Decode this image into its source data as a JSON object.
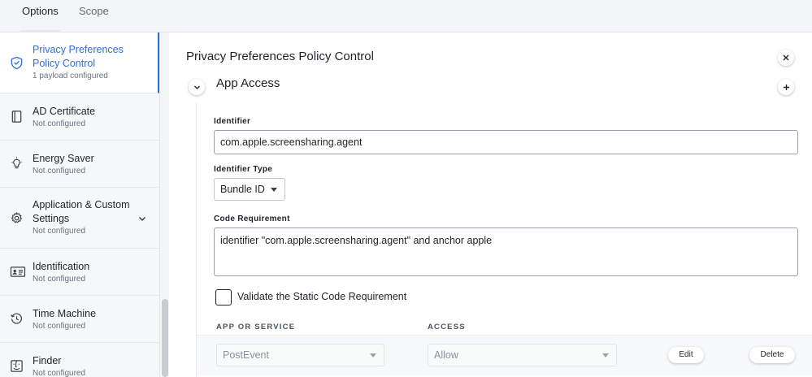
{
  "tabs": [
    {
      "label": "Options",
      "active": true
    },
    {
      "label": "Scope",
      "active": false
    }
  ],
  "sidebar": {
    "items": [
      {
        "title": "Privacy Preferences Policy Control",
        "subtitle": "1 payload configured",
        "icon": "shield-icon",
        "active": true
      },
      {
        "title": "AD Certificate",
        "subtitle": "Not configured",
        "icon": "certificate-icon"
      },
      {
        "title": "Energy Saver",
        "subtitle": "Not configured",
        "icon": "lightbulb-icon"
      },
      {
        "title": "Application & Custom Settings",
        "subtitle": "Not configured",
        "icon": "gear-icon",
        "expandable": true
      },
      {
        "title": "Identification",
        "subtitle": "Not configured",
        "icon": "id-card-icon"
      },
      {
        "title": "Time Machine",
        "subtitle": "Not configured",
        "icon": "history-icon"
      },
      {
        "title": "Finder",
        "subtitle": "Not configured",
        "icon": "finder-icon"
      }
    ]
  },
  "main": {
    "title": "Privacy Preferences Policy Control",
    "section_title": "App Access",
    "identifier_label": "Identifier",
    "identifier_value": "com.apple.screensharing.agent",
    "identifier_type_label": "Identifier Type",
    "identifier_type_value": "Bundle ID",
    "code_requirement_label": "Code Requirement",
    "code_requirement_value": "identifier \"com.apple.screensharing.agent\" and anchor apple",
    "validate_label": "Validate the Static Code Requirement",
    "validate_checked": false,
    "table": {
      "col_app": "APP OR SERVICE",
      "col_access": "ACCESS",
      "rows": [
        {
          "service": "PostEvent",
          "access": "Allow",
          "edit": "Edit",
          "delete": "Delete"
        }
      ]
    }
  },
  "colors": {
    "accent": "#2f6fd6",
    "border": "#9aa1aa"
  }
}
